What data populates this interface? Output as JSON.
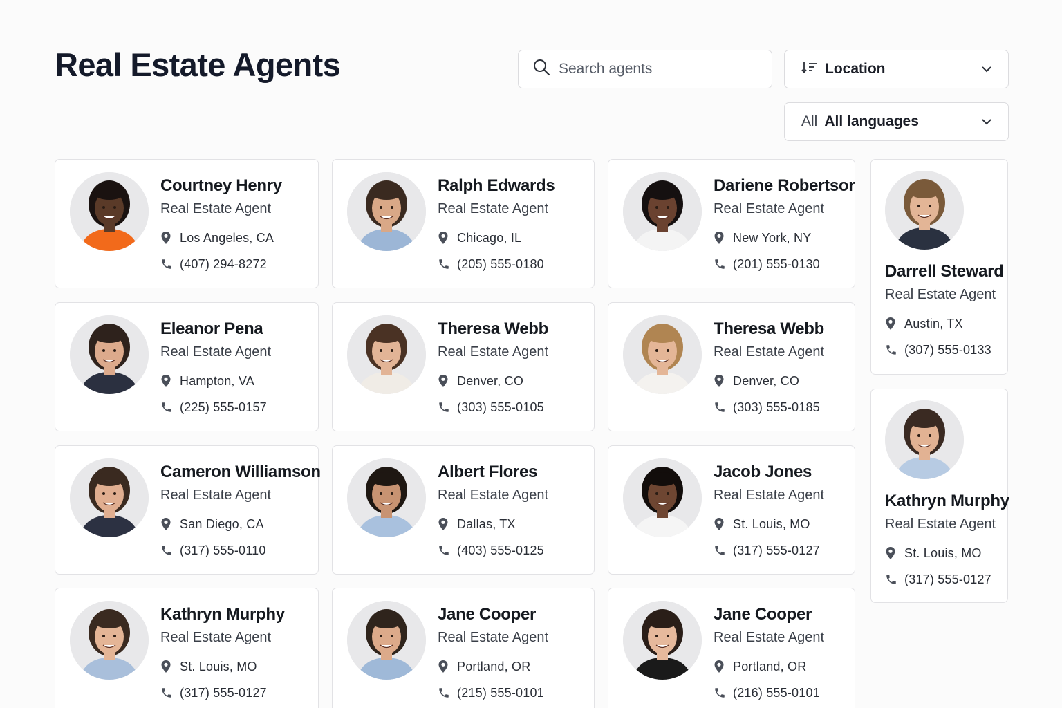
{
  "page": {
    "title": "Real Estate Agents"
  },
  "search": {
    "placeholder": "Search agents"
  },
  "filters": {
    "location_label": "Location",
    "language_prefix": "All",
    "language_label": "All languages"
  },
  "agents": [
    {
      "name": "Courtney Henry",
      "role": "Real Estate Agent",
      "location": "Los Angeles, CA",
      "phone": "(407) 294-8272",
      "skin": "#5a3a28",
      "hair": "#1a1210",
      "shirt": "#f26a1b"
    },
    {
      "name": "Ralph Edwards",
      "role": "Real Estate Agent",
      "location": "Chicago, IL",
      "phone": "(205) 555-0180",
      "skin": "#d9a887",
      "hair": "#3a2a20",
      "shirt": "#9cb6d6"
    },
    {
      "name": "Dariene Robertsor",
      "role": "Real Estate Agent",
      "location": "New York, NY",
      "phone": "(201) 555-0130",
      "skin": "#6a4230",
      "hair": "#151010",
      "shirt": "#f4f4f4"
    },
    {
      "name": "Darrell Steward",
      "role": "Real Estate Agent",
      "location": "Austin, TX",
      "phone": "(307) 555-0133",
      "skin": "#e3b596",
      "hair": "#7a5a3a",
      "shirt": "#2a3140"
    },
    {
      "name": "Eleanor Pena",
      "role": "Real Estate Agent",
      "location": "Hampton, VA",
      "phone": "(225) 555-0157",
      "skin": "#dcaa8c",
      "hair": "#2e221c",
      "shirt": "#2b3040"
    },
    {
      "name": "Theresa  Webb",
      "role": "Real Estate Agent",
      "location": "Denver, CO",
      "phone": "(303) 555-0105",
      "skin": "#e2b496",
      "hair": "#4a3224",
      "shirt": "#f0ece6"
    },
    {
      "name": "Theresa Webb",
      "role": "Real Estate Agent",
      "location": "Denver, CO",
      "phone": "(303) 555-0185",
      "skin": "#e4b697",
      "hair": "#b08552",
      "shirt": "#f4f2ef"
    },
    {
      "name": "Cameron Williamson",
      "role": "Real Estate Agent",
      "location": "San Diego, CA",
      "phone": "(317) 555-0110",
      "skin": "#e0ae90",
      "hair": "#3a2a20",
      "shirt": "#2c3142"
    },
    {
      "name": "Albert Flores",
      "role": "Real Estate Agent",
      "location": "Dallas, TX",
      "phone": "(403) 555-0125",
      "skin": "#c89372",
      "hair": "#1e1712",
      "shirt": "#a9c1de"
    },
    {
      "name": "Jacob Jones",
      "role": "Real Estate Agent",
      "location": "St. Louis, MO",
      "phone": "(317) 555-0127",
      "skin": "#6e4632",
      "hair": "#120d0b",
      "shirt": "#f5f5f5"
    },
    {
      "name": "Kathryn Murphy",
      "role": "Real Estate Agent",
      "location": "St. Louis, MO",
      "phone": "(317) 555-0127",
      "skin": "#e2b293",
      "hair": "#3a2a22",
      "shirt": "#b7cbe3"
    },
    {
      "name": "Kathryn Murphy",
      "role": "Real Estate Agent",
      "location": "St. Louis, MO",
      "phone": "(317) 555-0127",
      "skin": "#e4b596",
      "hair": "#3a2a20",
      "shirt": "#a9bfdb"
    },
    {
      "name": "Jane Cooper",
      "role": "Real Estate Agent",
      "location": "Portland, OR",
      "phone": "(215) 555-0101",
      "skin": "#dcaa8a",
      "hair": "#2f241c",
      "shirt": "#9fb9d8"
    },
    {
      "name": "Jane Cooper",
      "role": "Real Estate Agent",
      "location": "Portland, OR",
      "phone": "(216) 555-0101",
      "skin": "#e6b99c",
      "hair": "#2a1e18",
      "shirt": "#1a1a1a"
    }
  ]
}
